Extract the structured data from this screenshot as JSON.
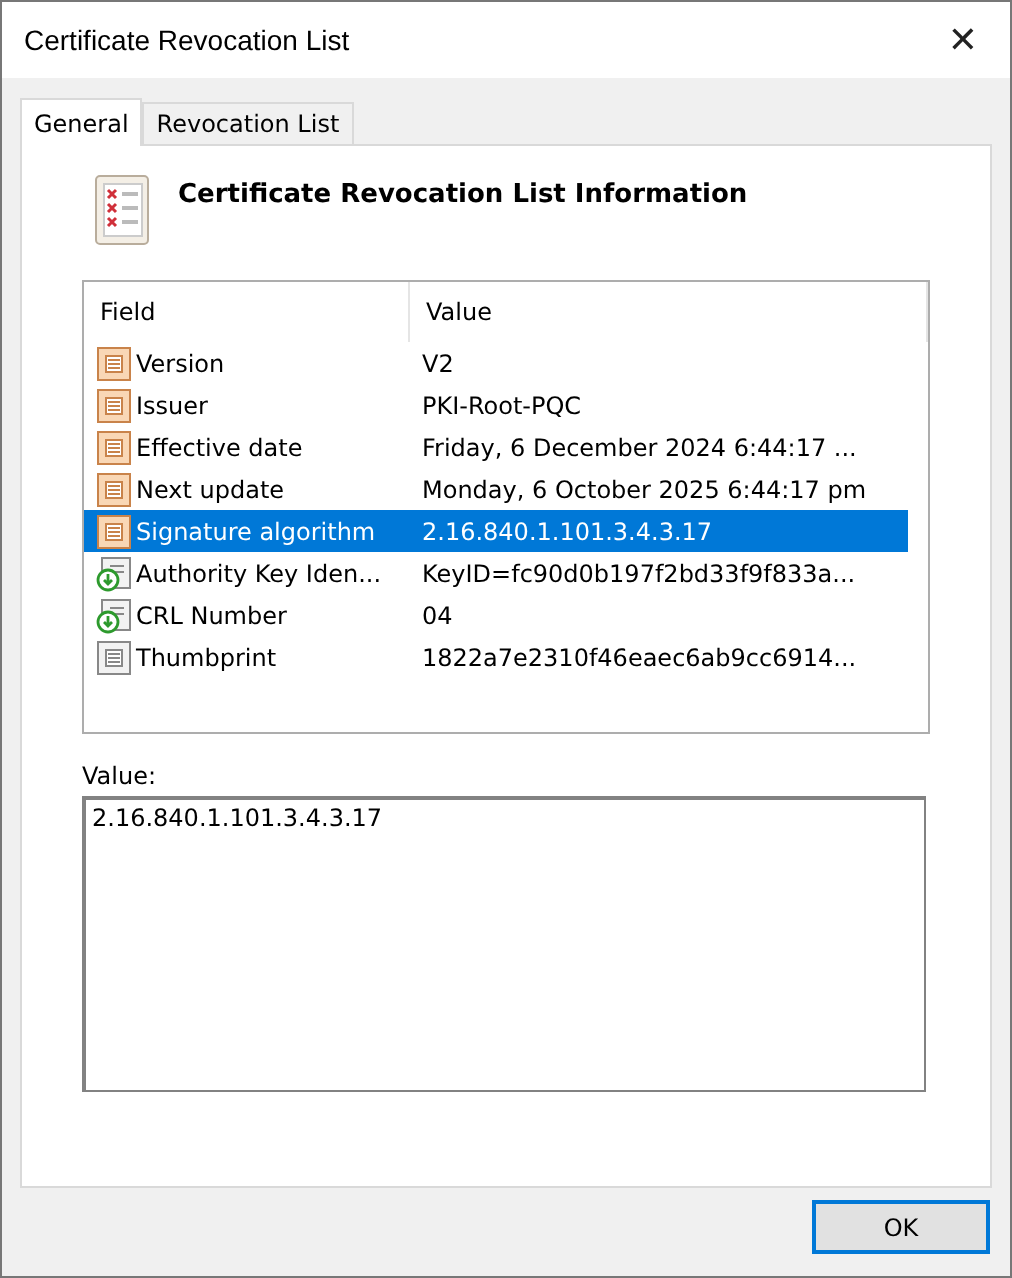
{
  "window": {
    "title": "Certificate Revocation List",
    "close": "✕"
  },
  "tabs": [
    {
      "label": "General",
      "selected": true
    },
    {
      "label": "Revocation List",
      "selected": false
    }
  ],
  "heading": "Certificate Revocation List Information",
  "table": {
    "columns": [
      "Field",
      "Value"
    ],
    "rows": [
      {
        "kind": "field",
        "field": "Version",
        "value": "V2",
        "selected": false
      },
      {
        "kind": "field",
        "field": "Issuer",
        "value": "PKI-Root-PQC",
        "selected": false
      },
      {
        "kind": "field",
        "field": "Effective date",
        "value": "Friday, 6 December 2024 6:44:17 ...",
        "selected": false
      },
      {
        "kind": "field",
        "field": "Next update",
        "value": "Monday, 6 October 2025 6:44:17 pm",
        "selected": false
      },
      {
        "kind": "field",
        "field": "Signature algorithm",
        "value": "2.16.840.1.101.3.4.3.17",
        "selected": true
      },
      {
        "kind": "extension",
        "field": "Authority Key Iden...",
        "value": "KeyID=fc90d0b197f2bd33f9f833a...",
        "selected": false
      },
      {
        "kind": "extension",
        "field": "CRL Number",
        "value": "04",
        "selected": false
      },
      {
        "kind": "plain",
        "field": "Thumbprint",
        "value": "1822a7e2310f46eaec6ab9cc6914...",
        "selected": false
      }
    ]
  },
  "value_label": "Value:",
  "value_text": "2.16.840.1.101.3.4.3.17",
  "buttons": [
    "OK"
  ]
}
